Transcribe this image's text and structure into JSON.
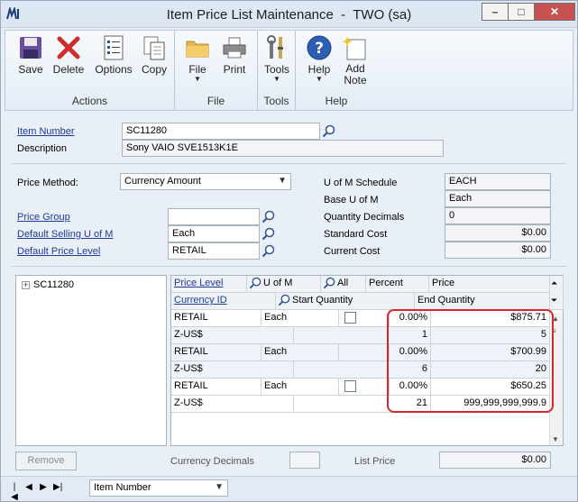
{
  "window": {
    "title": "Item Price List Maintenance  -  TWO (sa)",
    "controls": [
      "–",
      "□",
      "✕"
    ]
  },
  "ribbon": {
    "groups": [
      {
        "label": "Actions",
        "buttons": [
          "Save",
          "Delete",
          "Options",
          "Copy"
        ]
      },
      {
        "label": "File",
        "buttons": [
          "File",
          "Print"
        ]
      },
      {
        "label": "Tools",
        "buttons": [
          "Tools"
        ]
      },
      {
        "label": "Help",
        "buttons": [
          "Help",
          "Add\nNote"
        ]
      }
    ],
    "save": "Save",
    "delete": "Delete",
    "options": "Options",
    "copy": "Copy",
    "file": "File",
    "print": "Print",
    "tools": "Tools",
    "help": "Help",
    "add_note": "Add Note",
    "actions_label": "Actions",
    "file_label": "File",
    "tools_label": "Tools",
    "help_label": "Help"
  },
  "form": {
    "item_number_label": "Item Number",
    "item_number": "SC11280",
    "description_label": "Description",
    "description": "Sony VAIO SVE1513K1E",
    "price_method_label": "Price Method:",
    "price_method": "Currency Amount",
    "price_group_label": "Price Group",
    "price_group": "",
    "default_selling_uom_label": "Default Selling U of M",
    "default_selling_uom": "Each",
    "default_price_level_label": "Default Price Level",
    "default_price_level": "RETAIL",
    "uom_schedule_label": "U of M Schedule",
    "uom_schedule": "EACH",
    "base_uom_label": "Base U of M",
    "base_uom": "Each",
    "quantity_decimals_label": "Quantity Decimals",
    "quantity_decimals": "0",
    "standard_cost_label": "Standard Cost",
    "standard_cost": "$0.00",
    "current_cost_label": "Current Cost",
    "current_cost": "$0.00"
  },
  "tree": {
    "root": "SC11280"
  },
  "grid": {
    "headers": {
      "price_level": "Price Level",
      "uom": "U of M",
      "all": "All",
      "percent": "Percent",
      "price": "Price",
      "currency_id": "Currency ID",
      "start_quantity": "Start Quantity",
      "end_quantity": "End Quantity"
    },
    "rows": [
      {
        "price_level": "RETAIL",
        "uom": "Each",
        "percent": "0.00%",
        "price": "$875.71",
        "currency": "Z-US$",
        "start": "1",
        "end": "5"
      },
      {
        "price_level": "RETAIL",
        "uom": "Each",
        "percent": "0.00%",
        "price": "$700.99",
        "currency": "Z-US$",
        "start": "6",
        "end": "20"
      },
      {
        "price_level": "RETAIL",
        "uom": "Each",
        "percent": "0.00%",
        "price": "$650.25",
        "currency": "Z-US$",
        "start": "21",
        "end": "999,999,999,999.9"
      }
    ]
  },
  "bottom": {
    "remove_label": "Remove",
    "currency_decimals_label": "Currency Decimals",
    "currency_decimals": "",
    "list_price_label": "List Price",
    "list_price": "$0.00"
  },
  "statusbar": {
    "sort_by": "Item Number"
  },
  "colors": {
    "accent": "#1f3b9b",
    "highlight": "#d8262d"
  }
}
